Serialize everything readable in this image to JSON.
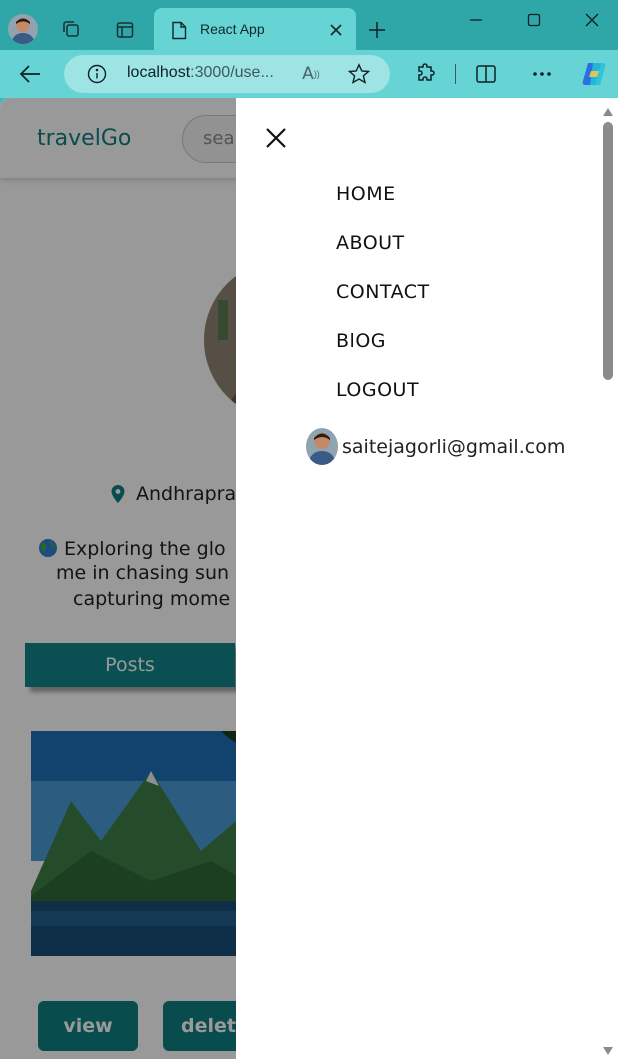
{
  "browser": {
    "tab_title": "React App",
    "url_host": "localhost",
    "url_rest": ":3000/use...",
    "read_aloud_glyph": "A",
    "read_aloud_sup": "))"
  },
  "page": {
    "brand": "travelGo",
    "search_placeholder": "sea",
    "location": "Andhrapra",
    "bio_line1": "Exploring the glo",
    "bio_line2": "me in chasing sun",
    "bio_line3": "capturing mome",
    "posts_tab": "Posts",
    "view_button": "view",
    "delete_button": "delete"
  },
  "menu": {
    "items": [
      "HOME",
      "ABOUT",
      "CONTACT",
      "BlOG",
      "LOGOUT"
    ],
    "user_email": "saitejagorli@gmail.com"
  },
  "colors": {
    "accent": "#11868a",
    "browser_frame": "#2fa7a9",
    "browser_toolbar": "#66d4d4"
  }
}
